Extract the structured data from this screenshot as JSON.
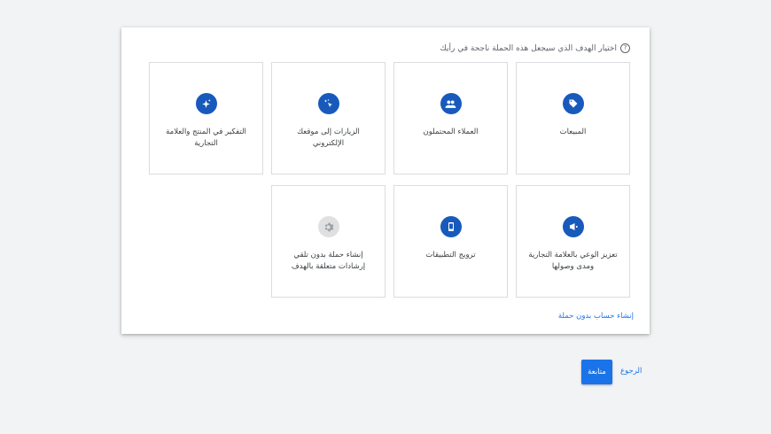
{
  "header": {
    "title": "اختيار الهدف الذي سيجعل هذه الحملة ناجحة في رأيك"
  },
  "tiles": [
    {
      "label": "المبيعات",
      "icon": "tag-icon"
    },
    {
      "label": "العملاء المحتملون",
      "icon": "people-icon"
    },
    {
      "label": "الزيارات إلى موقعك الإلكتروني",
      "icon": "sparkle-cursor-icon"
    },
    {
      "label": "التفكير في المنتج والعلامة التجارية",
      "icon": "sparkle-icon"
    },
    {
      "label": "تعزيز الوعي بالعلامة التجارية ومدى وصولها",
      "icon": "megaphone-icon"
    },
    {
      "label": "ترويج التطبيقات",
      "icon": "phone-icon"
    },
    {
      "label": "إنشاء حملة بدون تلقي إرشادات متعلقة بالهدف",
      "icon": "gear-icon"
    }
  ],
  "footer": {
    "create_account_link": "إنشاء حساب بدون حملة"
  },
  "actions": {
    "continue_label": "متابعة",
    "back_label": "الرجوع"
  },
  "colors": {
    "accent": "#1a73e8",
    "icon_bg": "#185abc",
    "disabled_icon_bg": "#e0e0e0"
  }
}
